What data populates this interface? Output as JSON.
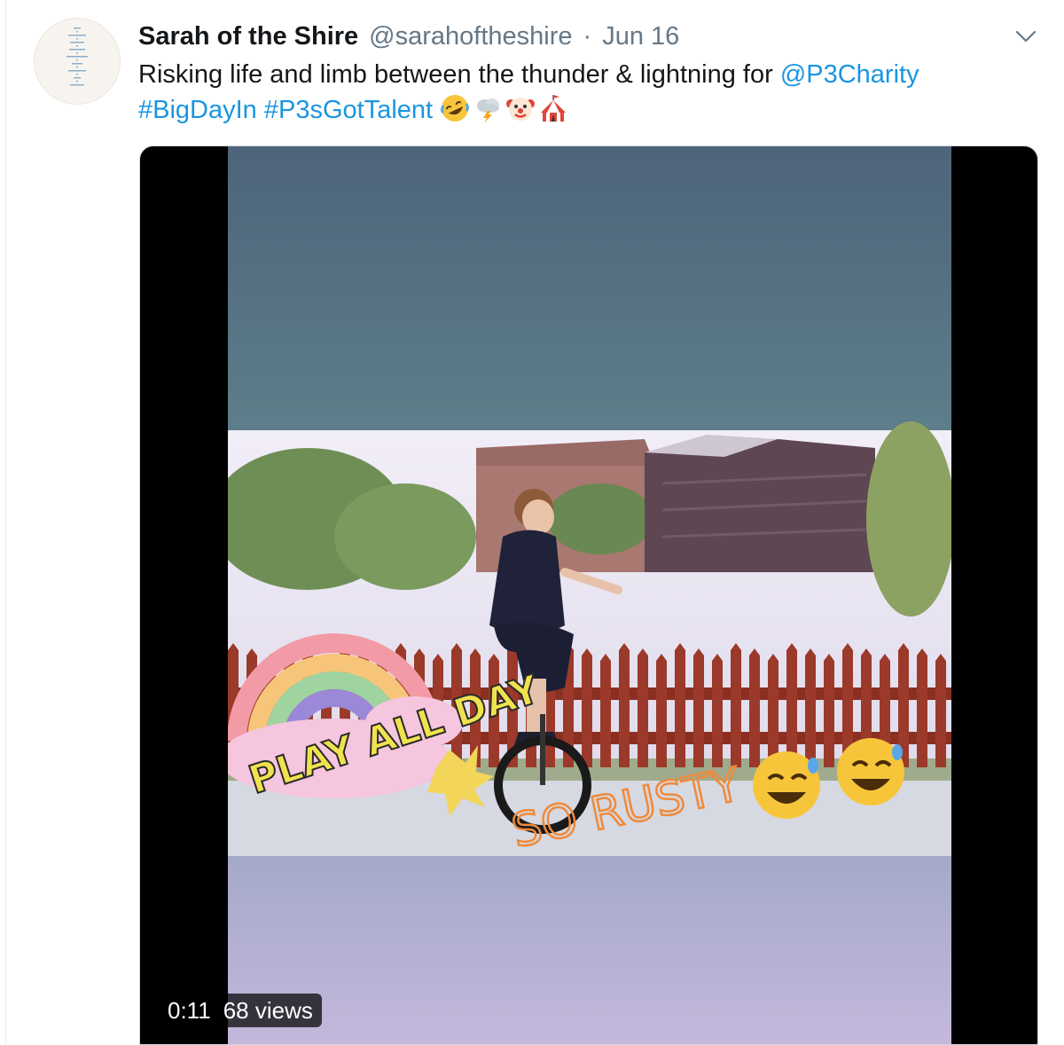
{
  "tweet": {
    "display_name": "Sarah of the Shire",
    "handle": "@sarahoftheshire",
    "separator": "·",
    "date": "Jun 16",
    "text_part1": "Risking life and limb between the thunder & lightning for ",
    "mention": "@P3Charity",
    "hashtag1": "#BigDayIn",
    "hashtag2": "#P3sGotTalent",
    "emojis": [
      "rolling-on-floor-laughing-emoji",
      "cloud-lightning-emoji",
      "clown-face-emoji",
      "circus-tent-emoji"
    ]
  },
  "video": {
    "duration": "0:11",
    "views": "68 views",
    "overlay_sticker": "PLAY ALL DAY",
    "overlay_caption": "SO RUSTY"
  },
  "colors": {
    "link": "#1b95e0",
    "text": "#14171a",
    "secondary": "#657786"
  }
}
